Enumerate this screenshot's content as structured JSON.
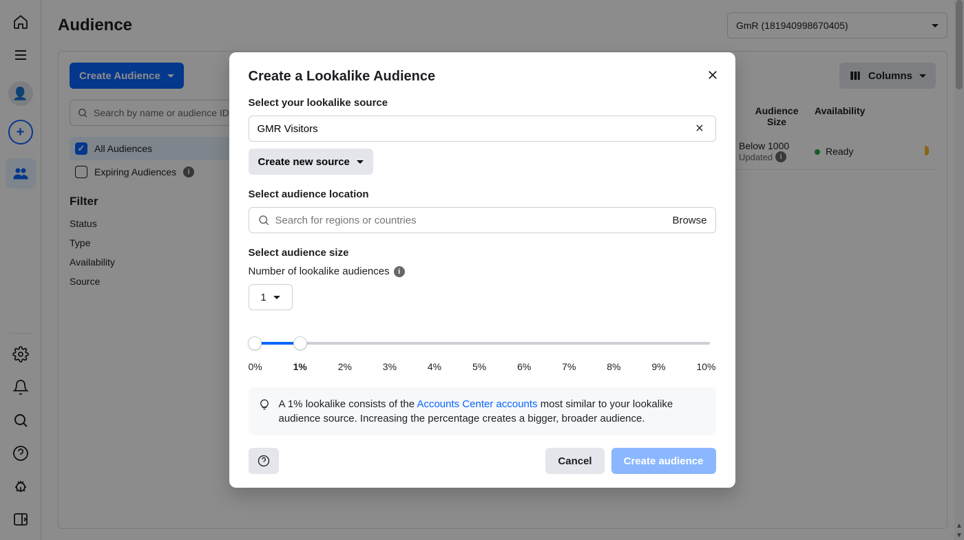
{
  "header": {
    "title": "Audience",
    "account_label": "GmR (181940998670405)"
  },
  "toolbar": {
    "create_label": "Create Audience",
    "columns_label": "Columns",
    "search_placeholder": "Search by name or audience ID"
  },
  "sidebar": {
    "all_label": "All Audiences",
    "expiring_label": "Expiring Audiences",
    "filter_heading": "Filter",
    "items": [
      "Status",
      "Type",
      "Availability",
      "Source"
    ]
  },
  "table": {
    "col_size": "Audience\nSize",
    "col_avail": "Availability",
    "row0": {
      "size": "Below 1000",
      "updated": "Updated",
      "avail": "Ready"
    }
  },
  "modal": {
    "title": "Create a Lookalike Audience",
    "source_label": "Select your lookalike source",
    "source_value": "GMR Visitors",
    "create_source_label": "Create new source",
    "location_label": "Select audience location",
    "location_placeholder": "Search for regions or countries",
    "browse_label": "Browse",
    "size_label": "Select audience size",
    "count_label": "Number of lookalike audiences",
    "count_value": "1",
    "ticks": [
      "0%",
      "1%",
      "2%",
      "3%",
      "4%",
      "5%",
      "6%",
      "7%",
      "8%",
      "9%",
      "10%"
    ],
    "info_pre": "A 1% lookalike consists of the ",
    "info_link": "Accounts Center accounts",
    "info_post": " most similar to your lookalike audience source. Increasing the percentage creates a bigger, broader audience.",
    "cancel_label": "Cancel",
    "create_label": "Create audience"
  }
}
